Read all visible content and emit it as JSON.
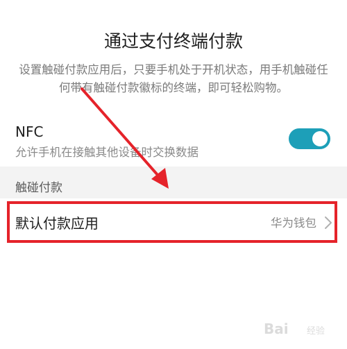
{
  "header": {
    "title": "通过支付终端付款",
    "description": "设置触碰付款应用后，只要手机处于开机状态，用手机触碰任何带有触碰付款徽标的终端，即可轻松购物。"
  },
  "nfc": {
    "title": "NFC",
    "subtitle": "允许手机在接触其他设备时交换数据",
    "enabled": true,
    "toggle_color": "#1d9fb8"
  },
  "section": {
    "label": "触碰付款"
  },
  "default_payment": {
    "label": "默认付款应用",
    "value": "华为钱包"
  },
  "annotation": {
    "box_color": "#e5232a",
    "arrow_color": "#e5232a"
  },
  "watermark": {
    "text": "Bai",
    "sub": "经验"
  }
}
